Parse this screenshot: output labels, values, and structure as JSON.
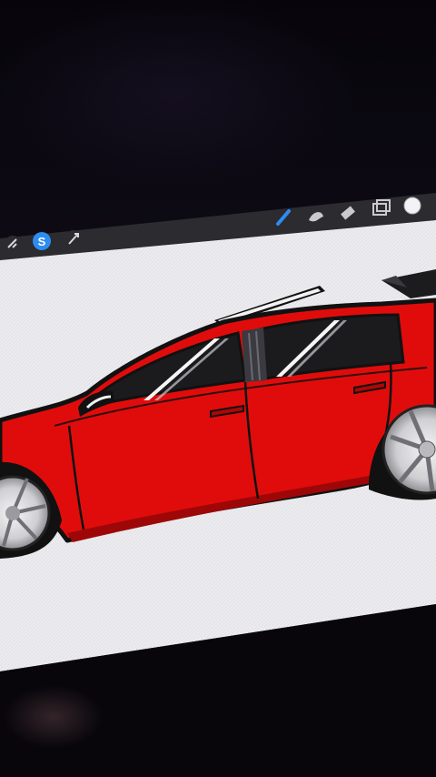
{
  "app": {
    "name": "Procreate"
  },
  "toolbar": {
    "left_tools": [
      {
        "name": "adjustments-icon"
      },
      {
        "name": "selection-icon",
        "active": true
      },
      {
        "name": "transform-icon"
      }
    ],
    "right_tools": [
      {
        "name": "brush-icon",
        "active": true
      },
      {
        "name": "smudge-icon"
      },
      {
        "name": "eraser-icon"
      },
      {
        "name": "layers-icon"
      },
      {
        "name": "color-icon"
      }
    ]
  },
  "canvas": {
    "subject": "car-illustration",
    "colors": {
      "body": "#e00c0c",
      "body_shadow": "#b40808",
      "outline": "#111111",
      "glass": "#1b1b1e",
      "paper": "#ececef",
      "accent_blue": "#2d8cf0"
    }
  }
}
